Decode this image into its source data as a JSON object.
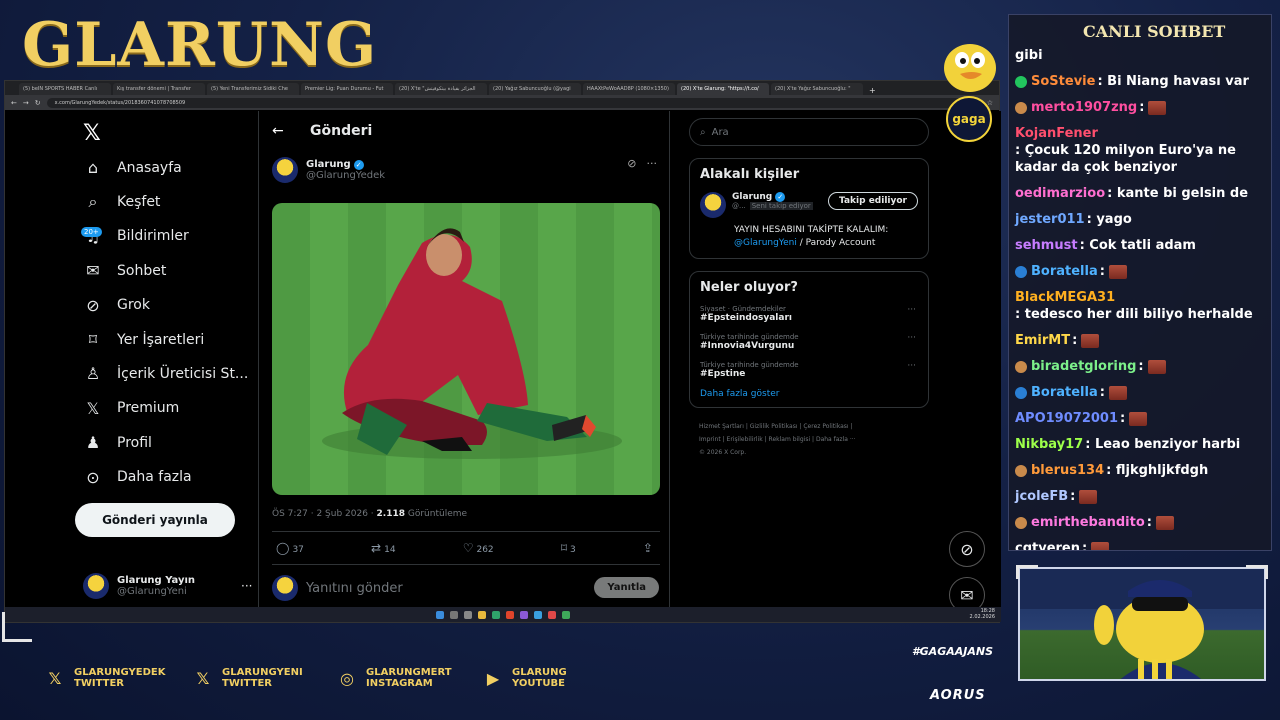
{
  "overlay": {
    "brand": "GLARUNG",
    "hashtag": "#GAGAAJANS",
    "sponsor": "AORUS",
    "badge": "gaga",
    "socials": [
      {
        "icon": "x-icon",
        "line1": "GLARUNGYEDEK",
        "line2": "TWITTER"
      },
      {
        "icon": "x-icon",
        "line1": "GLARUNGYENI",
        "line2": "TWITTER"
      },
      {
        "icon": "instagram-icon",
        "line1": "GLARUNGMERT",
        "line2": "INSTAGRAM"
      },
      {
        "icon": "youtube-icon",
        "line1": "GLARUNG",
        "line2": "YOUTUBE"
      }
    ]
  },
  "browser": {
    "tabs": [
      "(5) beIN SPORTS HABER Canlı",
      "Kış transfer dönemi | Transfer",
      "(5) Yeni Transferimiz Sidiki Che",
      "Premier Lig: Puan Durumu - Fut",
      "(20) X'te \"الجزائر بقيادة بيتكوفيتش",
      "(20) Yağız Sabuncuoğlu (@yagi",
      "HAAXtPeWoAAD8P (1080×1350)",
      "(20) X'te Glarung: \"https://t.co/",
      "(20) X'te Yağız Sabuncuoğlu: \""
    ],
    "active_tab": 7,
    "url": "x.com/GlarungYedek/status/2018360741078708509"
  },
  "x": {
    "nav": [
      {
        "icon": "home-icon",
        "label": "Anasayfa"
      },
      {
        "icon": "search-icon",
        "label": "Keşfet"
      },
      {
        "icon": "bell-icon",
        "label": "Bildirimler"
      },
      {
        "icon": "mail-icon",
        "label": "Sohbet"
      },
      {
        "icon": "grok-icon",
        "label": "Grok"
      },
      {
        "icon": "bookmark-icon",
        "label": "Yer İşaretleri"
      },
      {
        "icon": "creator-icon",
        "label": "İçerik Üreticisi St..."
      },
      {
        "icon": "x-icon",
        "label": "Premium"
      },
      {
        "icon": "profile-icon",
        "label": "Profil"
      },
      {
        "icon": "more-icon",
        "label": "Daha fazla"
      }
    ],
    "notif_badge": "20+",
    "post_button": "Gönderi yayınla",
    "account": {
      "name": "Glarung Yayın",
      "handle": "@GlarungYeni"
    },
    "post": {
      "header": "Gönderi",
      "author_name": "Glarung",
      "author_handle": "@GlarungYedek",
      "time": "ÖS 7:27 · 2 Şub 2026 ·",
      "views": "2.118",
      "views_label": "Görüntüleme",
      "replies": "37",
      "reposts": "14",
      "likes": "262",
      "bookmarks": "3",
      "reply_placeholder": "Yanıtını gönder",
      "reply_button": "Yanıtla"
    },
    "search_placeholder": "Ara",
    "related": {
      "title": "Alakalı kişiler",
      "name": "Glarung",
      "handle": "@...",
      "follows_you": "Seni takip ediyor",
      "follow_button": "Takip ediliyor",
      "bio": "YAYIN HESABINI TAKİPTE KALALIM:",
      "bio_link": "@GlarungYeni",
      "bio_tail": " / Parody Account"
    },
    "trends": {
      "title": "Neler oluyor?",
      "items": [
        {
          "context": "Siyaset · Gündemdekiler",
          "tag": "#Epsteindosyaları"
        },
        {
          "context": "Türkiye tarihinde gündemde",
          "tag": "#Innovia4Vurgunu"
        },
        {
          "context": "Türkiye tarihinde gündemde",
          "tag": "#Epstine"
        }
      ],
      "more": "Daha fazla göster"
    },
    "footer": {
      "line1": "Hizmet Şartları  |  Gizlilik Politikası  |  Çerez Politikası  |",
      "line2": "Imprint  |  Erişilebilirlik  |  Reklam bilgisi  |  Daha fazla ···",
      "line3": "© 2026 X Corp."
    }
  },
  "taskbar": {
    "time": "18:28",
    "date": "2.02.2026"
  },
  "chat": {
    "title": "CANLI SOHBET",
    "messages": [
      {
        "user": "",
        "text": "gibi",
        "color": "#ffffff",
        "emote": false
      },
      {
        "user": "SoStevie",
        "text": ": Bi Niang havası var",
        "color": "#ff8c3a",
        "emote": false,
        "pre": "#22c55e"
      },
      {
        "user": "merto1907zng",
        "text": ":",
        "color": "#ff4fa0",
        "emote": true,
        "pre": "#c98a4b"
      },
      {
        "user": "KojanFener",
        "text": ": Çocuk 120 milyon Euro'ya ne kadar da çok benziyor",
        "color": "#ff4f6e",
        "emote": false
      },
      {
        "user": "oedimarzioo",
        "text": ": kante bi gelsin de",
        "color": "#ff6fd0",
        "emote": false
      },
      {
        "user": "jester011",
        "text": ": yago",
        "color": "#6fa8ff",
        "emote": false
      },
      {
        "user": "sehmust",
        "text": ": Cok tatli adam",
        "color": "#c77dff",
        "emote": false
      },
      {
        "user": "Boratella",
        "text": ":",
        "color": "#4fb2ff",
        "emote": true,
        "pre": "#2a7fd4"
      },
      {
        "user": "BlackMEGA31",
        "text": ": tedesco her dili biliyo herhalde",
        "color": "#ffb020",
        "emote": false
      },
      {
        "user": "EmirMT",
        "text": ":",
        "color": "#ffd84a",
        "emote": true
      },
      {
        "user": "biradetgloring",
        "text": ":",
        "color": "#7cf08a",
        "emote": true,
        "pre": "#c98a4b"
      },
      {
        "user": "Boratella",
        "text": ":",
        "color": "#4fb2ff",
        "emote": true,
        "pre": "#2a7fd4"
      },
      {
        "user": "APO19072001",
        "text": ":",
        "color": "#6f8cff",
        "emote": true
      },
      {
        "user": "Nikbay17",
        "text": ": Leao benziyor harbi",
        "color": "#9dff4a",
        "emote": false
      },
      {
        "user": "blerus134",
        "text": ": fljkghljkfdgh",
        "color": "#ff9a3a",
        "emote": false,
        "pre": "#c98a4b"
      },
      {
        "user": "jcoleFB",
        "text": ":",
        "color": "#b0c8ff",
        "emote": true
      },
      {
        "user": "emirthebandito",
        "text": ":",
        "color": "#ff7ae0",
        "emote": true,
        "pre": "#c98a4b"
      },
      {
        "user": "cgtyeren",
        "text": ":",
        "color": "#ffffff",
        "emote": true
      }
    ]
  },
  "colors": {
    "brand_gold": "#f1cf62",
    "x_blue": "#1d9bf0",
    "x_bg": "#000000"
  }
}
